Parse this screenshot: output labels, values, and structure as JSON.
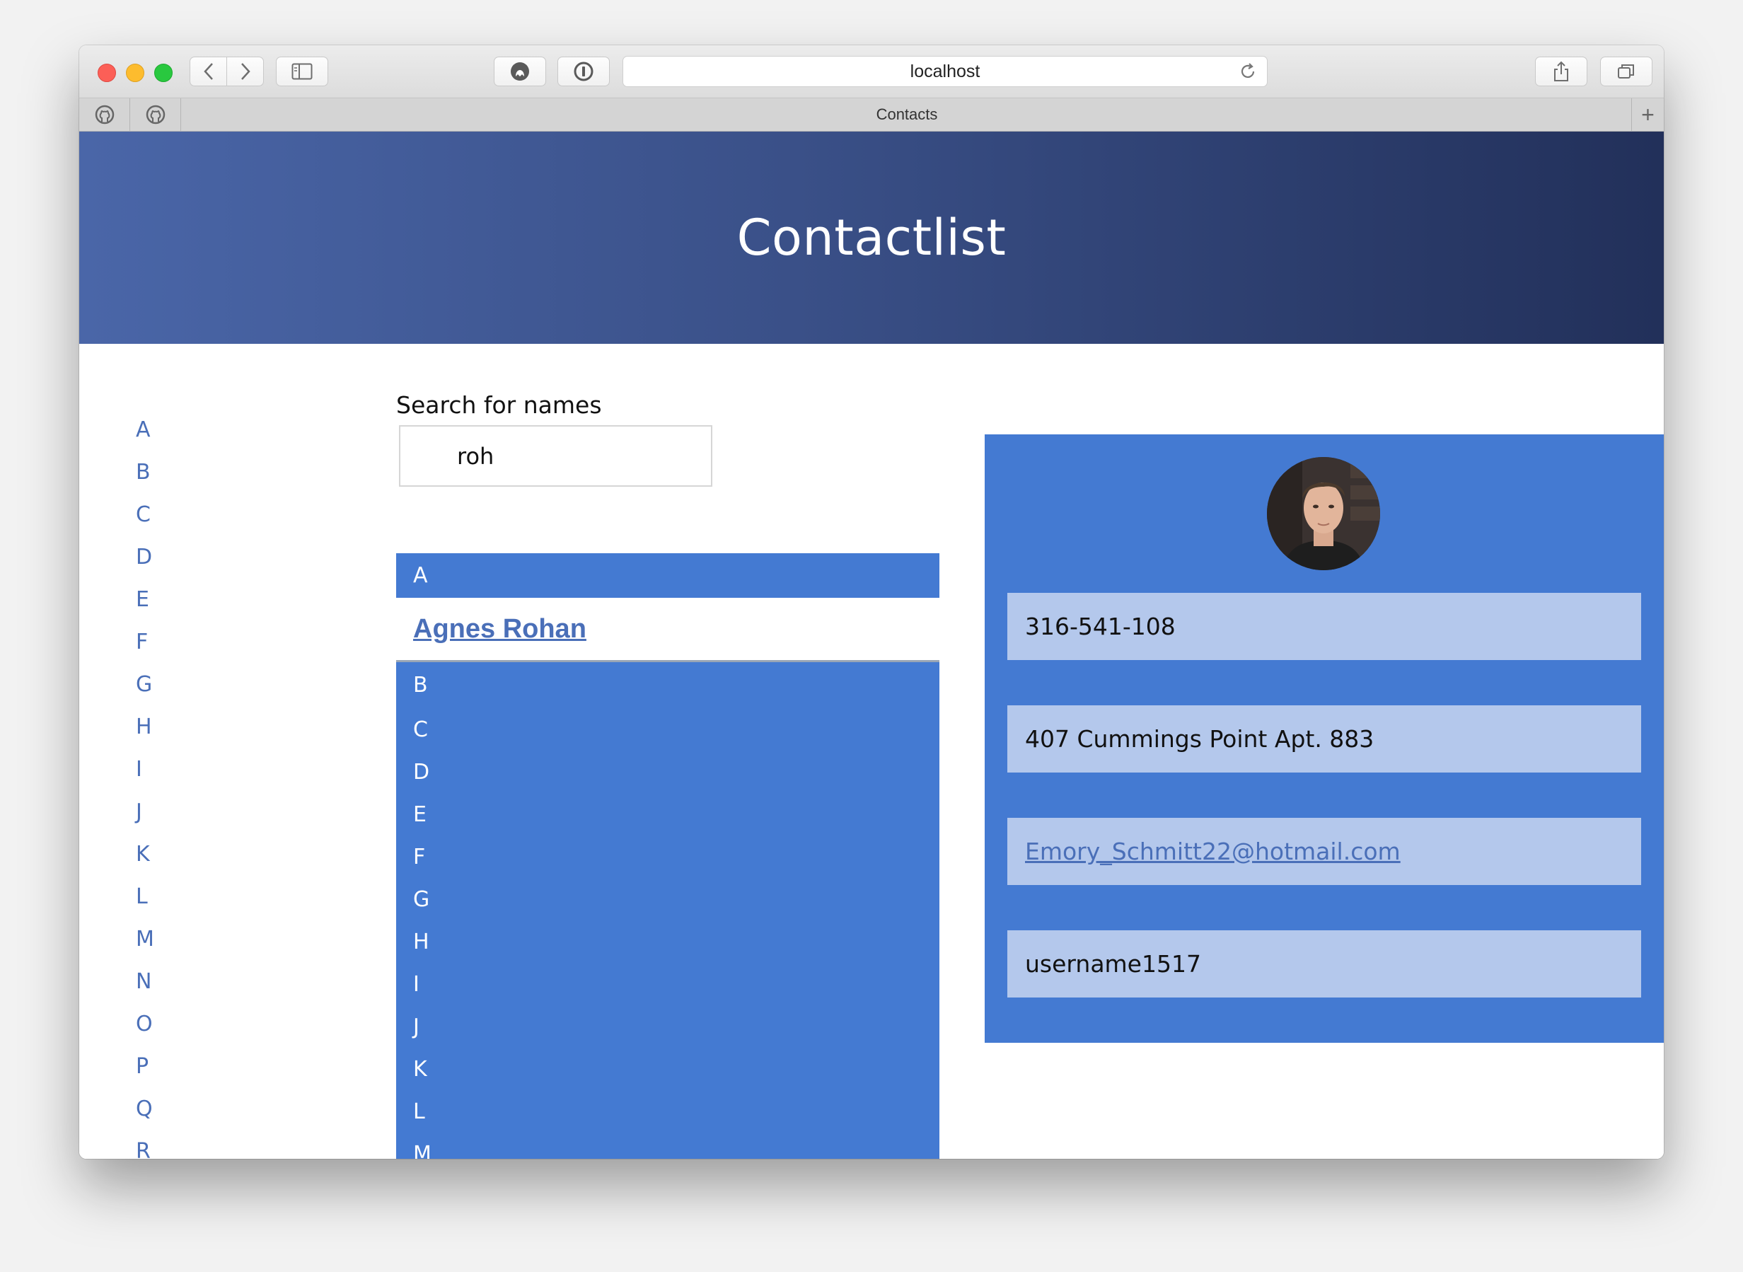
{
  "browser": {
    "address": "localhost",
    "tab_title": "Contacts"
  },
  "icons": {
    "back": "chevron-left-icon",
    "forward": "chevron-right-icon",
    "sidebar": "sidebar-icon",
    "extension1": "ghostery-icon",
    "extension2": "password-manager-icon",
    "reload": "reload-icon",
    "share": "share-icon",
    "tabs": "tab-overview-icon",
    "pinned": "github-icon",
    "new_tab": "plus-icon"
  },
  "page": {
    "title": "Contactlist",
    "search": {
      "label": "Search for names",
      "value": "roh"
    },
    "alphabet": [
      "A",
      "B",
      "C",
      "D",
      "E",
      "F",
      "G",
      "H",
      "I",
      "J",
      "K",
      "L",
      "M",
      "N",
      "O",
      "P",
      "Q",
      "R"
    ],
    "results": {
      "first_group": "A",
      "contacts": [
        "Agnes Rohan"
      ],
      "other_groups": [
        "B",
        "C",
        "D",
        "E",
        "F",
        "G",
        "H",
        "I",
        "J",
        "K",
        "L",
        "M"
      ]
    },
    "detail": {
      "phone": "316-541-108",
      "address": "407 Cummings Point Apt. 883",
      "email": "Emory_Schmitt22@hotmail.com",
      "username": "username1517"
    }
  },
  "colors": {
    "accent": "#447ad2",
    "field_bg": "#b4c8ec",
    "link": "#4a6fb8",
    "header_start": "#4a66a8",
    "header_end": "#22305a"
  }
}
